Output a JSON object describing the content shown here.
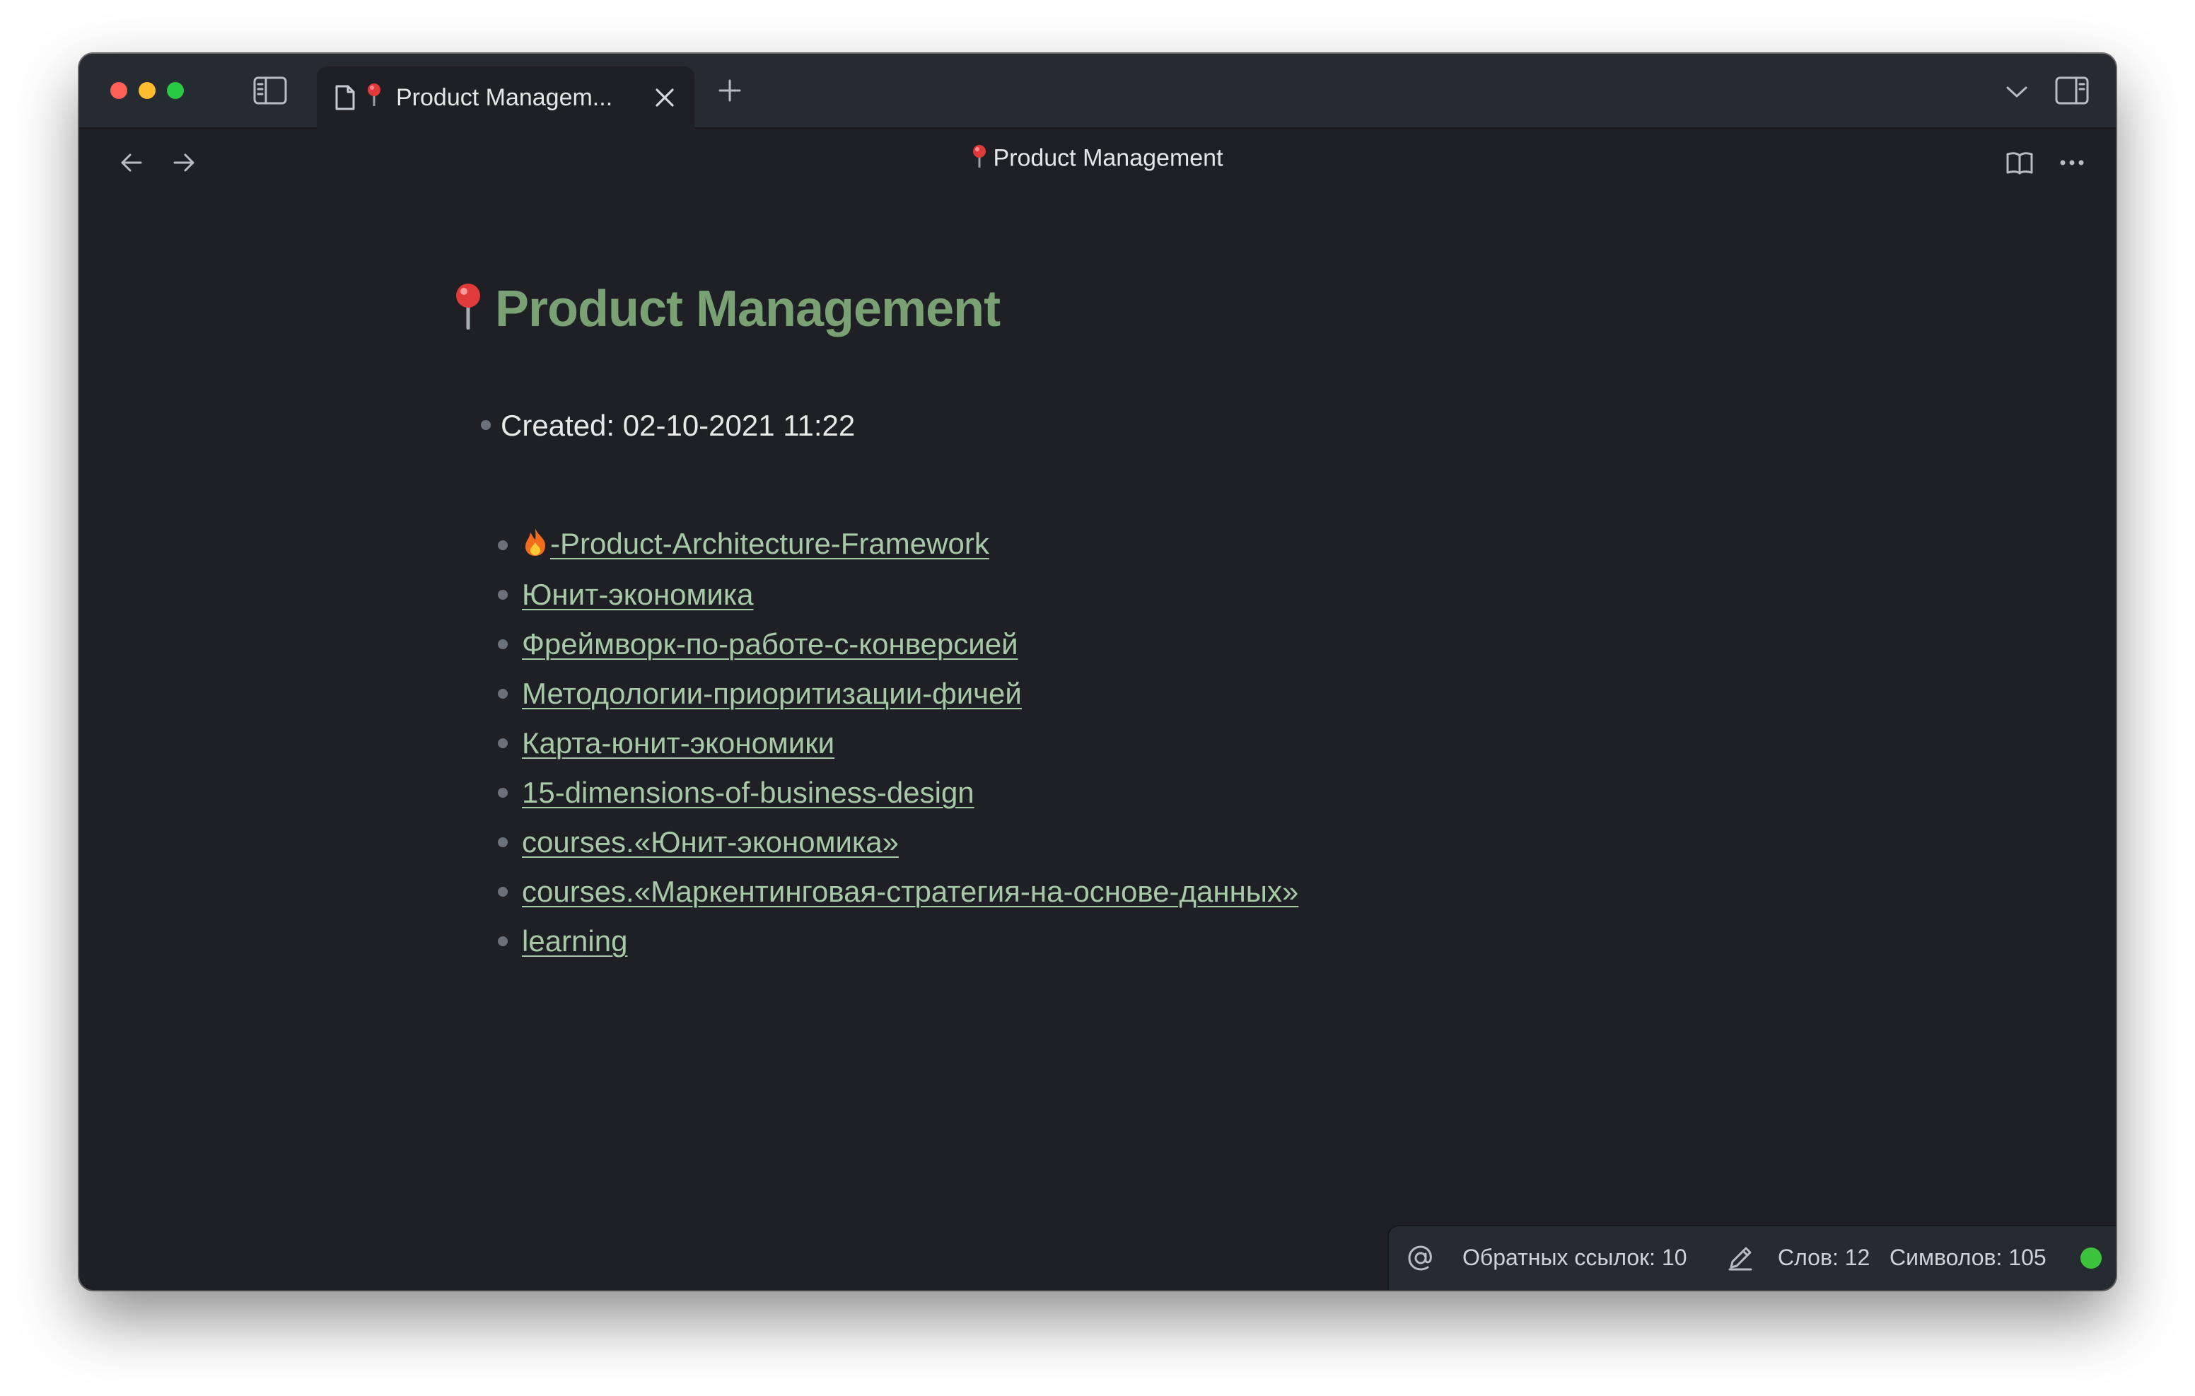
{
  "window": {
    "tab": {
      "title": "Product Managem..."
    },
    "nav": {
      "title": "Product Management"
    }
  },
  "note": {
    "title": "Product Management",
    "created": "Created: 02-10-2021 11:22",
    "links": [
      {
        "label": "-Product-Architecture-Framework",
        "prefix_emoji": "fire"
      },
      {
        "label": "Юнит-экономика"
      },
      {
        "label": "Фреймворк-по-работе-с-конверсией"
      },
      {
        "label": "Методологии-приоритизации-фичей"
      },
      {
        "label": "Карта-юнит-экономики"
      },
      {
        "label": "15-dimensions-of-business-design"
      },
      {
        "label": "courses.«Юнит-экономика»"
      },
      {
        "label": "courses.«Маркентинговая-стратегия-на-основе-данных»"
      },
      {
        "label": "learning"
      }
    ]
  },
  "statusbar": {
    "backlinks": "Обратных ссылок: 10",
    "words": "Слов: 12",
    "chars": "Символов: 105",
    "sync_color": "#3ec33e"
  },
  "colors": {
    "background": "#1e2025",
    "title_green": "#7aa173",
    "link_green": "#a6c9a6"
  },
  "icons": [
    "sidebar-left-icon",
    "file-icon",
    "pin-icon",
    "close-icon",
    "plus-icon",
    "chevron-down-icon",
    "sidebar-right-icon",
    "arrow-left-icon",
    "arrow-right-icon",
    "book-icon",
    "more-icon",
    "at-icon",
    "pencil-icon",
    "fire-icon"
  ]
}
